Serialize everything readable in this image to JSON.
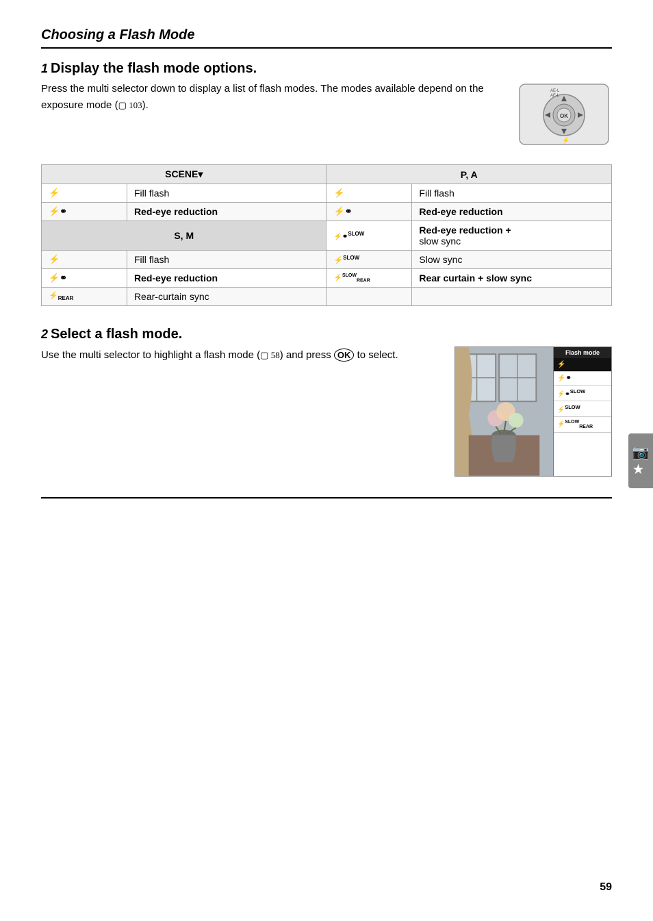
{
  "page": {
    "title": "Choosing a Flash Mode",
    "page_number": "59"
  },
  "step1": {
    "number": "1",
    "title": "Display the flash mode options.",
    "text": "Press the multi selector down to display a list of flash modes. The modes available depend on the exposure mode (",
    "ref": "⊞ 103",
    "text_end": ").",
    "table": {
      "left_sections": [
        {
          "header": "SCENE▾",
          "rows": [
            {
              "icon": "⚡",
              "label": "Fill flash"
            },
            {
              "icon": "⚡⦿",
              "label": "Red-eye reduction"
            }
          ]
        },
        {
          "header": "S, M",
          "rows": [
            {
              "icon": "⚡",
              "label": "Fill flash"
            },
            {
              "icon": "⚡⦿",
              "label": "Red-eye reduction"
            },
            {
              "icon": "⚡REAR",
              "label": "Rear-curtain sync"
            }
          ]
        }
      ],
      "right_sections": [
        {
          "header": "P, A",
          "rows": [
            {
              "icon": "⚡",
              "label": "Fill flash"
            },
            {
              "icon": "⚡⦿",
              "label": "Red-eye reduction"
            },
            {
              "icon": "⚡⦿SLOW",
              "label": "Red-eye reduction + slow sync"
            },
            {
              "icon": "⚡SLOW",
              "label": "Slow sync"
            },
            {
              "icon": "⚡ˢˡᵒʷREAR",
              "label": "Rear curtain + slow sync"
            }
          ]
        }
      ]
    }
  },
  "step2": {
    "number": "2",
    "title": "Select a flash mode.",
    "text": "Use the multi selector to highlight a flash mode (",
    "ref": "⊞ 58",
    "text_mid": ") and press ",
    "ok_symbol": "Ⓢ",
    "text_end": " to select.",
    "menu": {
      "title": "Flash mode",
      "items": [
        {
          "icon": "⚡",
          "active": true
        },
        {
          "icon": "⚡⦿",
          "active": false
        },
        {
          "icon": "⚡⦿SLOW",
          "active": false
        },
        {
          "icon": "⚡SLOW",
          "active": false
        },
        {
          "icon": "⚡REAR",
          "active": false
        }
      ]
    }
  },
  "side_tab": {
    "icon": "📷★"
  }
}
